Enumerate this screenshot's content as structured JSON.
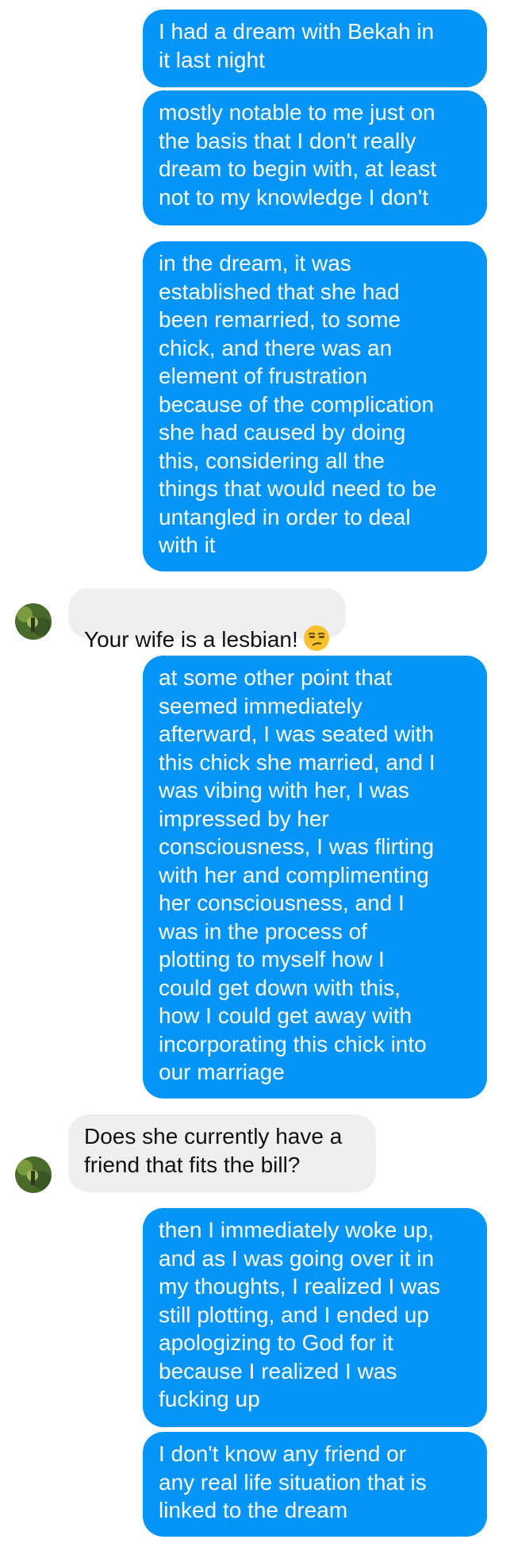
{
  "contact": {
    "avatar_label": "contact-avatar",
    "avatar_colors": [
      "#3f5a2a",
      "#6f8f3c",
      "#a9c060"
    ]
  },
  "colors": {
    "sent_bubble": "#0595f6",
    "received_bubble": "#efefef",
    "sent_text": "#ffffff",
    "received_text": "#111111"
  },
  "messages": [
    {
      "direction": "sent",
      "text": "I had a dream with Bekah in\nit last night"
    },
    {
      "direction": "sent",
      "text": "mostly notable to me just on\nthe basis that I don't really\ndream to begin with, at least\nnot to my knowledge I don't"
    },
    {
      "direction": "sent",
      "text": "in the dream, it was\nestablished that she had\nbeen remarried, to some\nchick, and there was an\nelement of frustration\nbecause of the complication\nshe had caused by doing\nthis, considering all the\nthings that would need to be\nuntangled in order to deal\nwith it"
    },
    {
      "direction": "received",
      "text": "Your wife is a lesbian!",
      "emoji": "unamused-face"
    },
    {
      "direction": "sent",
      "text": "at some other point that\nseemed immediately\nafterward, I was seated with\nthis chick she married, and I\nwas vibing with her, I was\nimpressed by her\nconsciousness, I was flirting\nwith her and complimenting\nher consciousness, and I\nwas in the process of\nplotting to myself how I\ncould get down with this,\nhow I could get away with\nincorporating this chick into\nour marriage"
    },
    {
      "direction": "received",
      "text": "Does she currently have a\nfriend that fits the bill?"
    },
    {
      "direction": "sent",
      "text": "then I immediately woke up,\nand as I was going over it in\nmy thoughts, I realized I was\nstill plotting, and I ended up\napologizing to God for it\nbecause I realized I was\nfucking up"
    },
    {
      "direction": "sent",
      "text": "I don't know any friend or\nany real life situation that is\nlinked to the dream"
    }
  ]
}
